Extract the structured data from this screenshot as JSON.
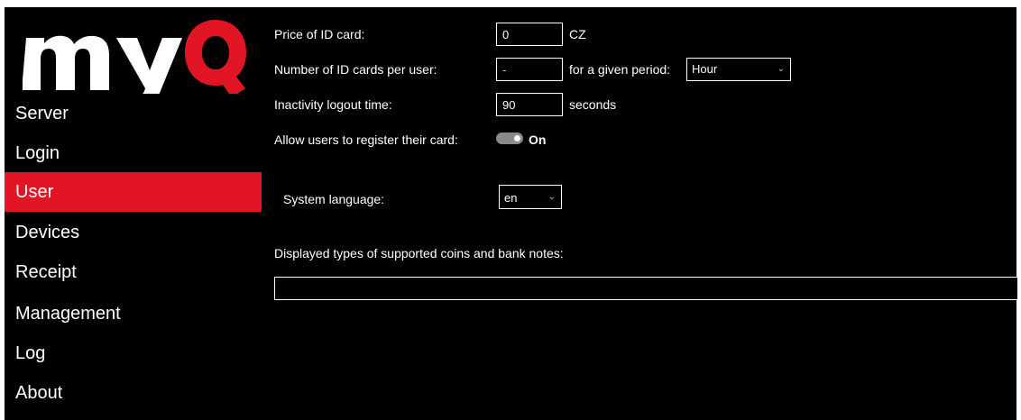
{
  "brand": {
    "logo_text": "myQ",
    "accent_color": "#e11523"
  },
  "sidebar": {
    "items": [
      {
        "label": "Server",
        "active": false
      },
      {
        "label": "Login",
        "active": false
      },
      {
        "label": "User",
        "active": true
      },
      {
        "label": "Devices",
        "active": false
      },
      {
        "label": "Receipt",
        "active": false
      },
      {
        "label": "Management",
        "active": false
      },
      {
        "label": "Log",
        "active": false
      },
      {
        "label": "About",
        "active": false
      }
    ]
  },
  "settings": {
    "price_id_card": {
      "label": "Price of ID card:",
      "value": "0",
      "unit": "CZ"
    },
    "cards_per_user": {
      "label": "Number of ID cards per user:",
      "value": "-",
      "period_label": "for a given period:",
      "period_value": "Hour"
    },
    "inactivity": {
      "label": "Inactivity logout time:",
      "value": "90",
      "unit": "seconds"
    },
    "register_card": {
      "label": "Allow users to register their card:",
      "state": "On"
    },
    "system_language": {
      "label": "System language:",
      "value": "en"
    },
    "coins_notes": {
      "label": "Displayed types of supported coins and bank notes:",
      "value": ""
    }
  }
}
